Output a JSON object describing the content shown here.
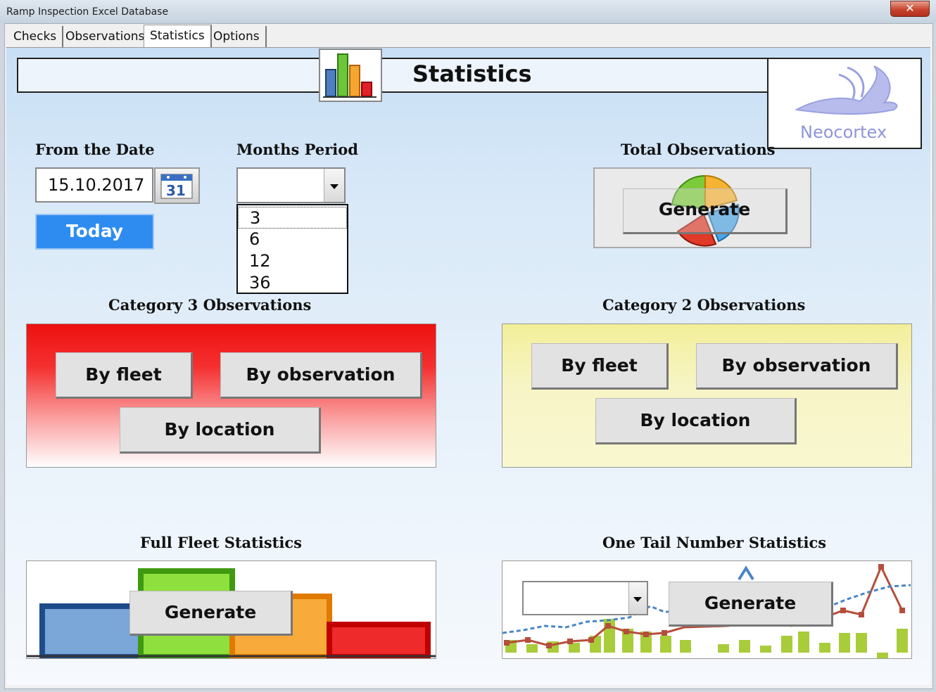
{
  "window": {
    "title": "Ramp Inspection Excel Database",
    "close_glyph": "✕"
  },
  "tabs": [
    {
      "label": "Checks"
    },
    {
      "label": "Observations"
    },
    {
      "label": "Statistics",
      "active": true
    },
    {
      "label": "Options"
    }
  ],
  "header": {
    "title": "Statistics",
    "logo_text": "Neocortex"
  },
  "date_section": {
    "label": "From the Date",
    "value": "15.10.2017",
    "today_button": "Today",
    "calendar_day": "31"
  },
  "months_section": {
    "label": "Months Period",
    "selected": "",
    "options": [
      "3",
      "6",
      "12",
      "36"
    ]
  },
  "total_obs": {
    "label": "Total Observations",
    "button": "Generate"
  },
  "category3": {
    "label": "Category 3 Observations",
    "by_fleet": "By fleet",
    "by_observation": "By observation",
    "by_location": "By location"
  },
  "category2": {
    "label": "Category 2 Observations",
    "by_fleet": "By fleet",
    "by_observation": "By observation",
    "by_location": "By location"
  },
  "full_fleet": {
    "label": "Full Fleet Statistics",
    "button": "Generate"
  },
  "tail_number": {
    "label": "One Tail Number Statistics",
    "selected": "",
    "button": "Generate"
  },
  "colors": {
    "accent": "#2e8cf0",
    "cat3": "#ee1010",
    "cat2": "#f2ef9a",
    "logo": "#8e95d8"
  }
}
